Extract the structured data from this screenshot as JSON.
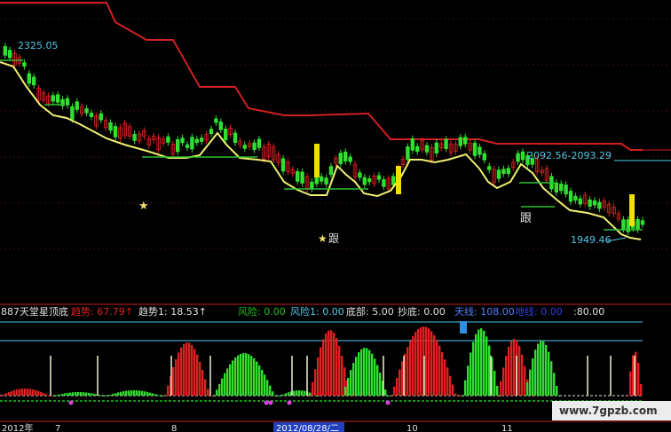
{
  "main_chart": {
    "label_high": "2325.05",
    "label_range": "2092.56-2093.29",
    "label_low": "1949.46",
    "signal_char": "跟",
    "star_glyph": "★",
    "colors": {
      "up_candle": "#e02020",
      "down_candle": "#30e030",
      "resistance_line": "#d02020",
      "trend_line": "#f0f070",
      "support_line": "#30c030",
      "label": "#50c8e8",
      "signal_bar": "#f0e000"
    }
  },
  "indicator": {
    "title": "887天堂星顶底",
    "items": [
      {
        "label": "趋势:",
        "value": "67.79",
        "arrow": "↑",
        "color": "#e02020"
      },
      {
        "label": "趋势1:",
        "value": "18.53",
        "arrow": "↑",
        "color": "#e0e0e0"
      },
      {
        "label": "风险:",
        "value": "0.00",
        "arrow": "",
        "color": "#20c020"
      },
      {
        "label": "风险1:",
        "value": "0.00",
        "arrow": "",
        "color": "#50c8e8"
      },
      {
        "label": "底部:",
        "value": "5.00",
        "arrow": "",
        "color": "#e0e0e0"
      },
      {
        "label": "抄底:",
        "value": "0.00",
        "arrow": "",
        "color": "#e0e0e0"
      },
      {
        "label": "天线:",
        "value": "108.00",
        "arrow": "",
        "color": "#5080ff"
      },
      {
        "label": "地线:",
        "value": "0.00",
        "arrow": "",
        "color": "#3040e0"
      },
      {
        "label": "",
        "value": ":80.00",
        "arrow": "",
        "color": "#e0e0e0"
      }
    ]
  },
  "time_axis": {
    "labels": [
      "2012年",
      "7",
      "8",
      "2012/08/28/二",
      "10",
      "11"
    ],
    "highlight_index": 3
  },
  "watermark": "www.7gpzb.com"
}
